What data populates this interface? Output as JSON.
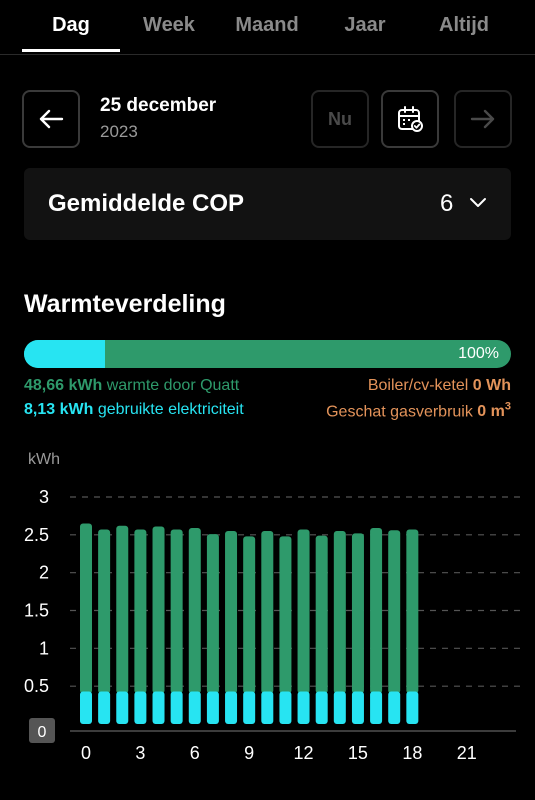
{
  "tabs": [
    {
      "label": "Dag",
      "active": true
    },
    {
      "label": "Week",
      "active": false
    },
    {
      "label": "Maand",
      "active": false
    },
    {
      "label": "Jaar",
      "active": false
    },
    {
      "label": "Altijd",
      "active": false
    }
  ],
  "date": {
    "main": "25 december",
    "year": "2023"
  },
  "nav": {
    "now_label": "Nu"
  },
  "selector": {
    "title": "Gemiddelde COP",
    "value": "6"
  },
  "section": {
    "title": "Warmteverdeling"
  },
  "distribution": {
    "electric_fraction": 0.167,
    "percent_label": "100%",
    "heat_value": "48,66 kWh",
    "heat_text": "warmte door Quatt",
    "elec_value": "8,13 kWh",
    "elec_text": "gebruikte elektriciteit",
    "boiler_text": "Boiler/cv-ketel",
    "boiler_value": "0 Wh",
    "gas_text": "Geschat gasverbruik",
    "gas_value": "0 m",
    "gas_unit_sup": "3"
  },
  "colors": {
    "heat": "#2e9a6b",
    "electric": "#27e4f2",
    "boiler": "#e3935a",
    "background": "#000000"
  },
  "chart_data": {
    "type": "bar",
    "ylabel": "kWh",
    "ylim": [
      0,
      3
    ],
    "yticks": [
      "0",
      "0.5",
      "1",
      "1.5",
      "2",
      "2.5",
      "3"
    ],
    "xticks": [
      "0",
      "3",
      "6",
      "9",
      "12",
      "15",
      "18",
      "21"
    ],
    "grid": true,
    "x": [
      0,
      1,
      2,
      3,
      4,
      5,
      6,
      7,
      8,
      9,
      10,
      11,
      12,
      13,
      14,
      15,
      16,
      17,
      18
    ],
    "series": [
      {
        "name": "gebruikte elektriciteit",
        "color": "#27e4f2",
        "values": [
          0.43,
          0.43,
          0.43,
          0.43,
          0.43,
          0.43,
          0.43,
          0.43,
          0.43,
          0.43,
          0.43,
          0.43,
          0.43,
          0.43,
          0.43,
          0.43,
          0.43,
          0.43,
          0.43
        ]
      },
      {
        "name": "warmte door Quatt",
        "color": "#2e9a6b",
        "values": [
          2.65,
          2.57,
          2.62,
          2.57,
          2.61,
          2.57,
          2.59,
          2.51,
          2.55,
          2.48,
          2.55,
          2.48,
          2.57,
          2.49,
          2.55,
          2.52,
          2.59,
          2.56,
          2.57
        ]
      }
    ]
  }
}
